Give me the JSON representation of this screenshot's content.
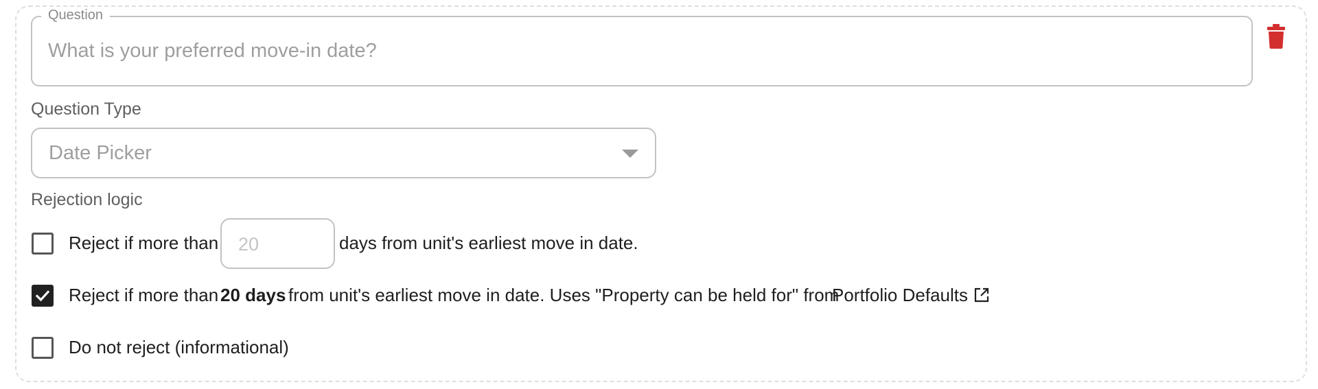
{
  "question": {
    "legend": "Question",
    "placeholder": "What is your preferred move-in date?"
  },
  "question_type": {
    "label": "Question Type",
    "selected": "Date Picker"
  },
  "rejection": {
    "label": "Rejection logic",
    "option1": {
      "prefix": "Reject if more than",
      "input_placeholder": "20",
      "suffix": "days from unit's earliest move in date.",
      "checked": false
    },
    "option2": {
      "prefix": "Reject if more than",
      "days": "20 days",
      "middle": "from unit's earliest move in date. Uses \"Property can be held for\" from",
      "link": "Portfolio Defaults",
      "checked": true
    },
    "option3": {
      "label": "Do not reject (informational)",
      "checked": false
    }
  },
  "icons": {
    "delete": "trash-icon",
    "dropdown": "chevron-down-icon",
    "external": "external-link-icon",
    "check": "check-icon"
  },
  "colors": {
    "delete": "#d32f2f",
    "checked_box": "#212121",
    "border": "#c2c2c2"
  }
}
